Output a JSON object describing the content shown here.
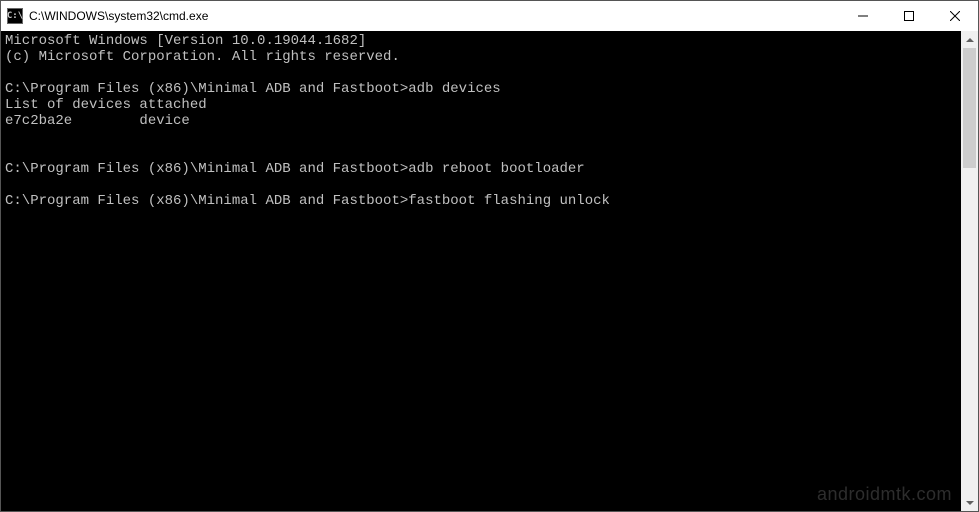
{
  "titlebar": {
    "icon_label": "C:\\",
    "title": "C:\\WINDOWS\\system32\\cmd.exe"
  },
  "terminal": {
    "lines": [
      "Microsoft Windows [Version 10.0.19044.1682]",
      "(c) Microsoft Corporation. All rights reserved.",
      "",
      "C:\\Program Files (x86)\\Minimal ADB and Fastboot>adb devices",
      "List of devices attached",
      "e7c2ba2e        device",
      "",
      "",
      "C:\\Program Files (x86)\\Minimal ADB and Fastboot>adb reboot bootloader",
      "",
      "C:\\Program Files (x86)\\Minimal ADB and Fastboot>fastboot flashing unlock"
    ]
  },
  "watermark": "androidmtk.com"
}
